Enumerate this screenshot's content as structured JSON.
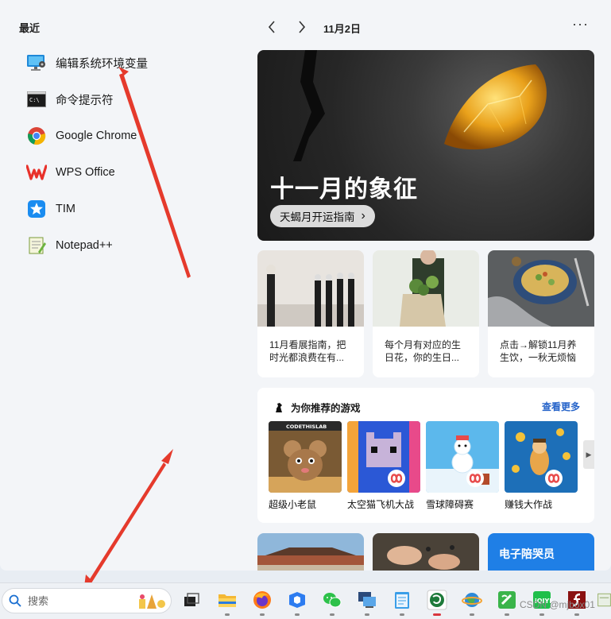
{
  "start": {
    "recent_title": "最近",
    "recent": [
      {
        "label": "编辑系统环境变量",
        "icon": "monitor-settings-icon"
      },
      {
        "label": "命令提示符",
        "icon": "command-prompt-icon"
      },
      {
        "label": "Google Chrome",
        "icon": "chrome-icon"
      },
      {
        "label": "WPS Office",
        "icon": "wps-icon"
      },
      {
        "label": "TIM",
        "icon": "tim-icon"
      },
      {
        "label": "Notepad++",
        "icon": "notepadpp-icon"
      }
    ]
  },
  "widgets": {
    "date": "11月2日",
    "more_label": "···",
    "hero": {
      "title": "十一月的象征",
      "pill": "天蝎月开运指南",
      "pill_chevron": "›"
    },
    "cards": [
      {
        "text": "11月看展指南，把时光都浪费在有..."
      },
      {
        "text": "每个月有对应的生日花，你的生日..."
      },
      {
        "text": "点击→解锁11月养生饮，一秋无烦恼"
      }
    ],
    "games": {
      "title": "为你推荐的游戏",
      "more": "查看更多",
      "items": [
        {
          "label": "超级小老鼠",
          "badge": "CODETHISLAB"
        },
        {
          "label": "太空猫飞机大战"
        },
        {
          "label": "雪球障碍赛"
        },
        {
          "label": "赚钱大作战"
        }
      ],
      "scroll_arrow": "▶"
    },
    "bottom": [
      {
        "title": ""
      },
      {
        "title": ""
      },
      {
        "title": "电子陪哭员"
      }
    ]
  },
  "taskbar": {
    "search_placeholder": "搜索",
    "icons": [
      "task-view-icon",
      "file-explorer-icon",
      "firefox-icon",
      "tim-taskbar-icon",
      "wechat-icon",
      "remote-desktop-icon",
      "notepad-icon",
      "browser-app-icon",
      "earth-app-icon",
      "green-app-icon",
      "iqiyi-icon",
      "flash-icon",
      "extra-app-icon"
    ]
  },
  "watermark": "CSDN @mjbox01",
  "colors": {
    "accent_blue": "#2563c9",
    "panel_bg": "#f3f5f8",
    "taskbar_bg": "#eef1f5",
    "arrow_red": "#e53a2c"
  }
}
